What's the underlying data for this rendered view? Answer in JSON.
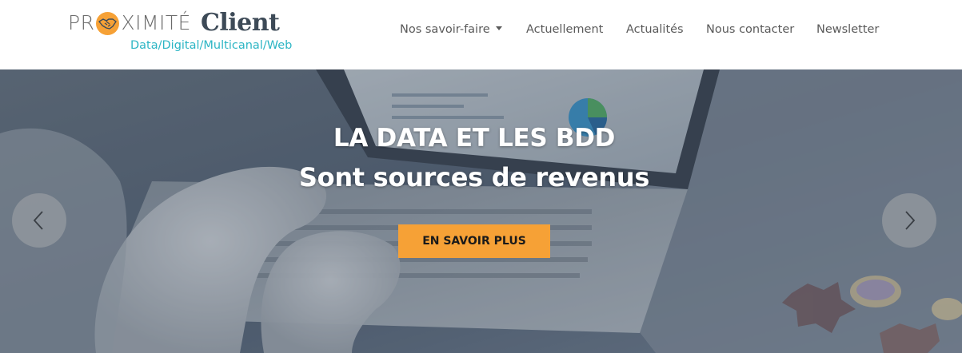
{
  "brand": {
    "logo_prefix": "PR",
    "logo_suffix": "XIMITÉ",
    "logo_strong": "Client",
    "tagline": "Data/Digital/Multicanal/Web",
    "colors": {
      "orange": "#f6a136",
      "teal": "#2bb5c4",
      "dark": "#3d4a57"
    }
  },
  "nav": {
    "items": [
      {
        "label": "Nos savoir-faire",
        "has_dropdown": true
      },
      {
        "label": "Actuellement"
      },
      {
        "label": "Actualités"
      },
      {
        "label": "Nous contacter"
      },
      {
        "label": "Newsletter"
      }
    ]
  },
  "hero": {
    "title": "LA DATA ET LES BDD",
    "subtitle": "Sont sources de revenus",
    "cta_label": "EN SAVOIR PLUS",
    "prev_icon": "chevron-left-icon",
    "next_icon": "chevron-right-icon"
  }
}
